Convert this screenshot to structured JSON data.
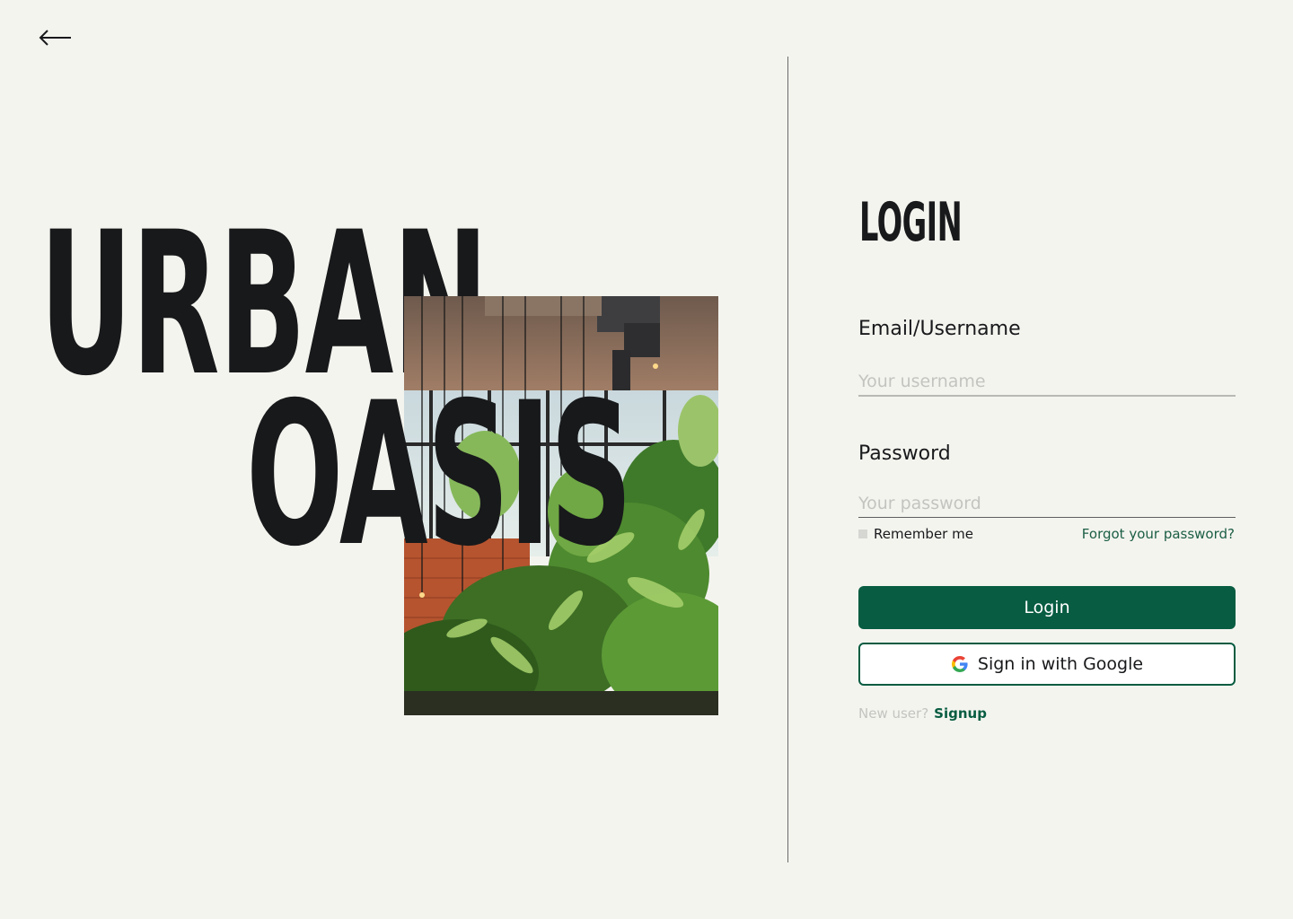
{
  "nav": {
    "back_icon": "arrow-left-icon"
  },
  "hero": {
    "line1": "URBAN",
    "line2": "OASIS",
    "photo_subject": "indoor plants in an industrial greenhouse cafe"
  },
  "login": {
    "title": "LOGIN",
    "email_label": "Email/Username",
    "email_placeholder": "Your username",
    "password_label": "Password",
    "password_placeholder": "Your password",
    "remember_label": "Remember me",
    "forgot_label": "Forgot your password?",
    "login_button": "Login",
    "google_button": "Sign in with Google",
    "google_icon": "google-g-icon",
    "new_user_text": "New user?",
    "signup_link": "Signup"
  },
  "colors": {
    "background": "#F4F4EF",
    "text": "#18191B",
    "accent": "#075C41",
    "placeholder": "#C3C3C0"
  }
}
